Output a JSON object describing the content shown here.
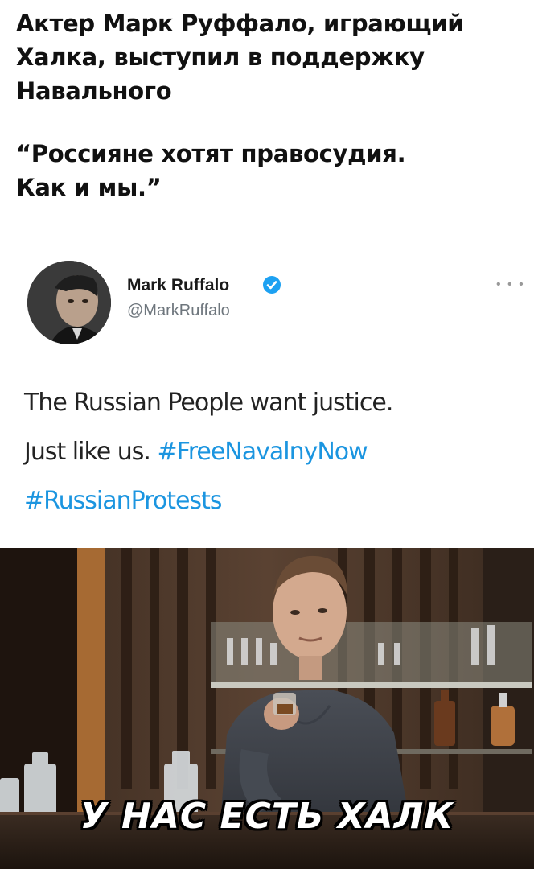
{
  "headline": {
    "line1": "Актер Марк Руффало, играющий",
    "line2": "Халка, выступил в поддержку",
    "line3": "Навального",
    "quote_line1": "“Россияне хотят правосудия.",
    "quote_line2": "Как и мы.”"
  },
  "tweet": {
    "author_name": "Mark Ruffalo",
    "handle": "@MarkRuffalo",
    "more_icon": "more-icon",
    "verified_icon": "verified-badge-icon",
    "text_line1": "The Russian People want justice.",
    "text_line2_plain": "Just like us. ",
    "hashtag1": "#FreeNavalnyNow",
    "hashtag2": "#RussianProtests",
    "hashtag_color": "#1b95e0"
  },
  "meme": {
    "caption": "У НАС ЕСТЬ ХАЛК"
  }
}
